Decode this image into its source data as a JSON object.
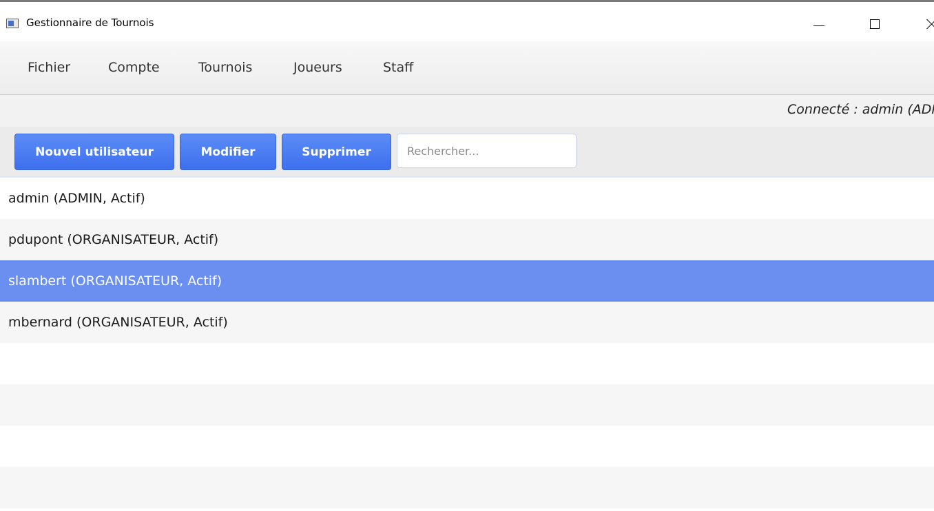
{
  "window": {
    "title": "Gestionnaire de Tournois"
  },
  "menu": {
    "items": [
      {
        "label": "Fichier"
      },
      {
        "label": "Compte"
      },
      {
        "label": "Tournois"
      },
      {
        "label": "Joueurs"
      },
      {
        "label": "Staff"
      }
    ]
  },
  "status": {
    "text": "Connecté : admin (ADMIN)"
  },
  "toolbar": {
    "new_label": "Nouvel utilisateur",
    "edit_label": "Modifier",
    "delete_label": "Supprimer",
    "search_placeholder": "Rechercher..."
  },
  "users": {
    "items": [
      {
        "label": "admin (ADMIN, Actif)"
      },
      {
        "label": "pdupont (ORGANISATEUR, Actif)"
      },
      {
        "label": "slambert (ORGANISATEUR, Actif)",
        "selected": true
      },
      {
        "label": "mbernard (ORGANISATEUR, Actif)"
      }
    ]
  },
  "colors": {
    "accent": "#4a7cf2",
    "selection": "#6b8ff1"
  }
}
